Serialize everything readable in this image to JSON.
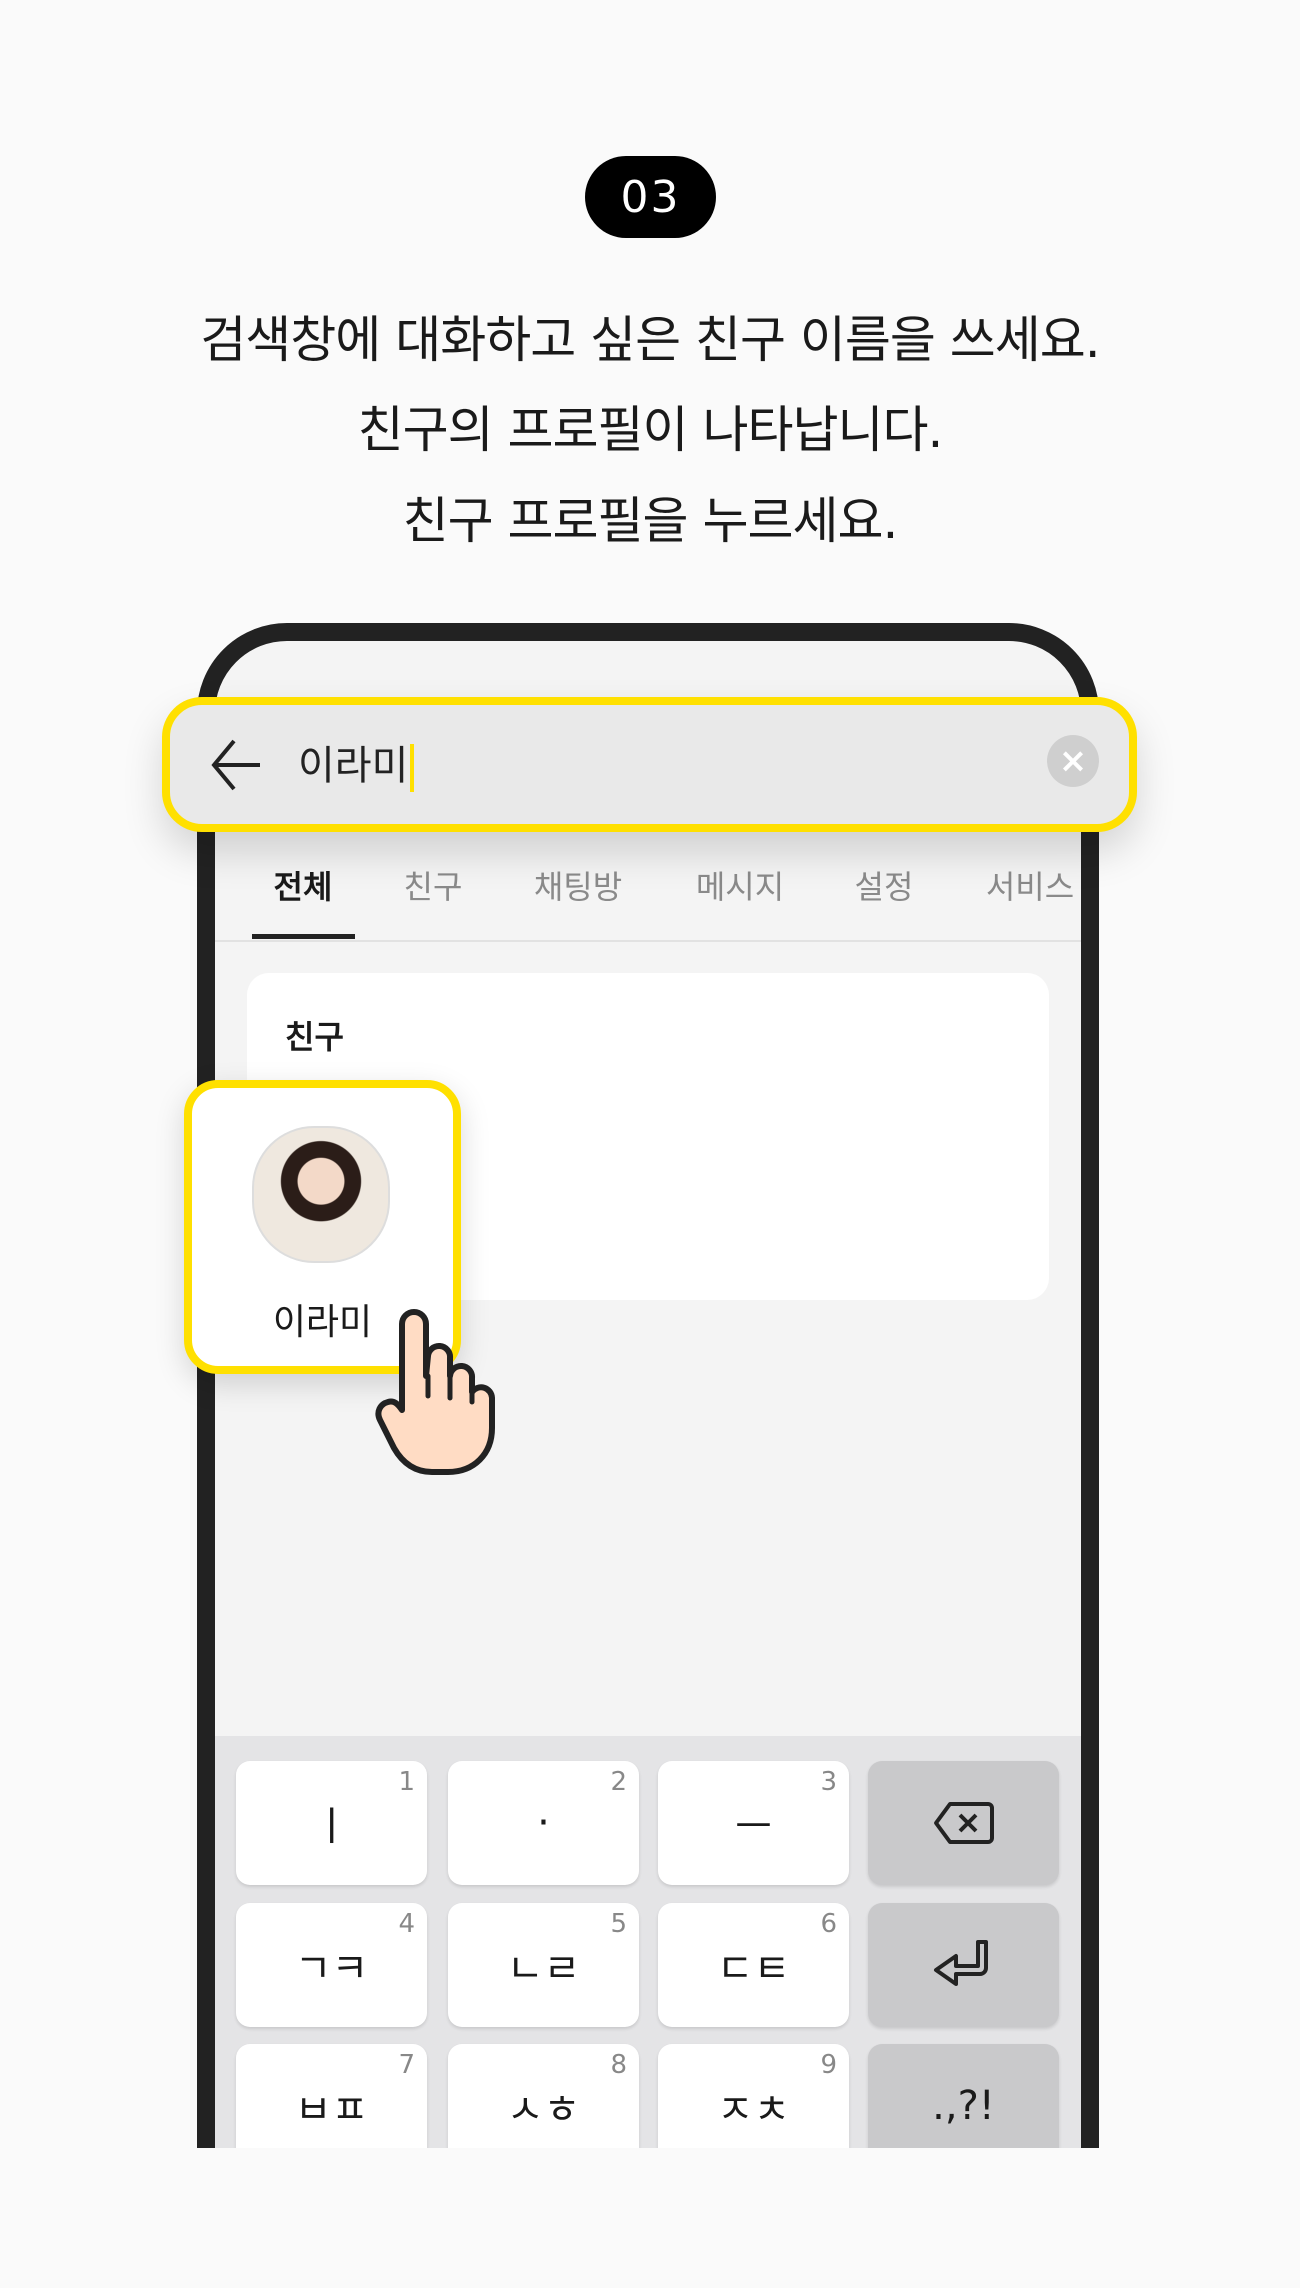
{
  "step_badge": "03",
  "instructions": [
    "검색창에 대화하고 싶은 친구 이름을 쓰세요.",
    "친구의 프로필이 나타납니다.",
    "친구 프로필을 누르세요."
  ],
  "search": {
    "value": "이라미",
    "back_icon": "arrow-left-icon",
    "clear_icon": "clear-icon"
  },
  "tabs": [
    {
      "label": "전체",
      "active": true
    },
    {
      "label": "친구"
    },
    {
      "label": "채팅방"
    },
    {
      "label": "메시지"
    },
    {
      "label": "설정"
    },
    {
      "label": "서비스"
    }
  ],
  "result_section": {
    "label": "친구"
  },
  "profile": {
    "name": "이라미"
  },
  "highlight_color": "#ffe000",
  "keyboard": {
    "keys": [
      {
        "char": "ㅣ",
        "num": "1"
      },
      {
        "char": "·",
        "num": "2"
      },
      {
        "char": "ㅡ",
        "num": "3"
      },
      {
        "icon": "backspace-icon"
      },
      {
        "char": "ㄱㅋ",
        "num": "4"
      },
      {
        "char": "ㄴㄹ",
        "num": "5"
      },
      {
        "char": "ㄷㅌ",
        "num": "6"
      },
      {
        "icon": "enter-icon"
      },
      {
        "char": "ㅂㅍ",
        "num": "7"
      },
      {
        "char": "ㅅㅎ",
        "num": "8"
      },
      {
        "char": "ㅈㅊ",
        "num": "9"
      },
      {
        "char": ".,?!"
      }
    ]
  }
}
